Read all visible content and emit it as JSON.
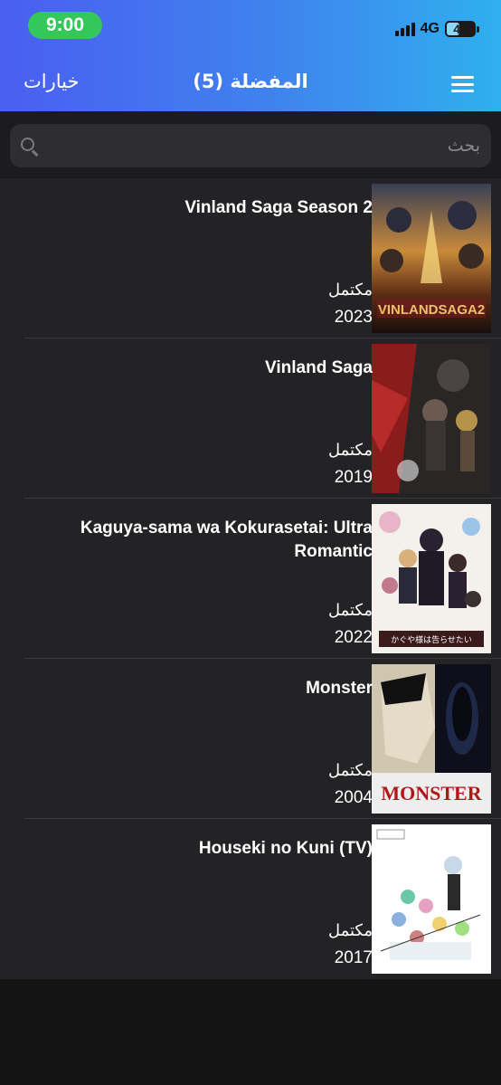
{
  "status_bar": {
    "time": "9:00",
    "network": "4G",
    "battery_level": "45",
    "battery_fraction": 0.45,
    "time_pill_color": "#34c759"
  },
  "nav": {
    "options_label": "خيارات",
    "title": "المفضلة (5)",
    "menu_icon": "hamburger-menu-icon"
  },
  "search": {
    "placeholder": "بحث",
    "value": "",
    "icon": "search-icon"
  },
  "favorites": [
    {
      "title": "Vinland Saga Season 2",
      "status": "مكتمل",
      "year": "2023"
    },
    {
      "title": "Vinland Saga",
      "status": "مكتمل",
      "year": "2019"
    },
    {
      "title": "Kaguya-sama wa Kokurasetai: Ultra Romantic",
      "status": "مكتمل",
      "year": "2022"
    },
    {
      "title": "Monster",
      "status": "مكتمل",
      "year": "2004"
    },
    {
      "title": "Houseki no Kuni (TV)",
      "status": "مكتمل",
      "year": "2017"
    }
  ],
  "colors": {
    "header_gradient_start": "#4a5ef0",
    "header_gradient_end": "#2fb0ee",
    "list_background": "#232326",
    "page_background": "#141414"
  }
}
